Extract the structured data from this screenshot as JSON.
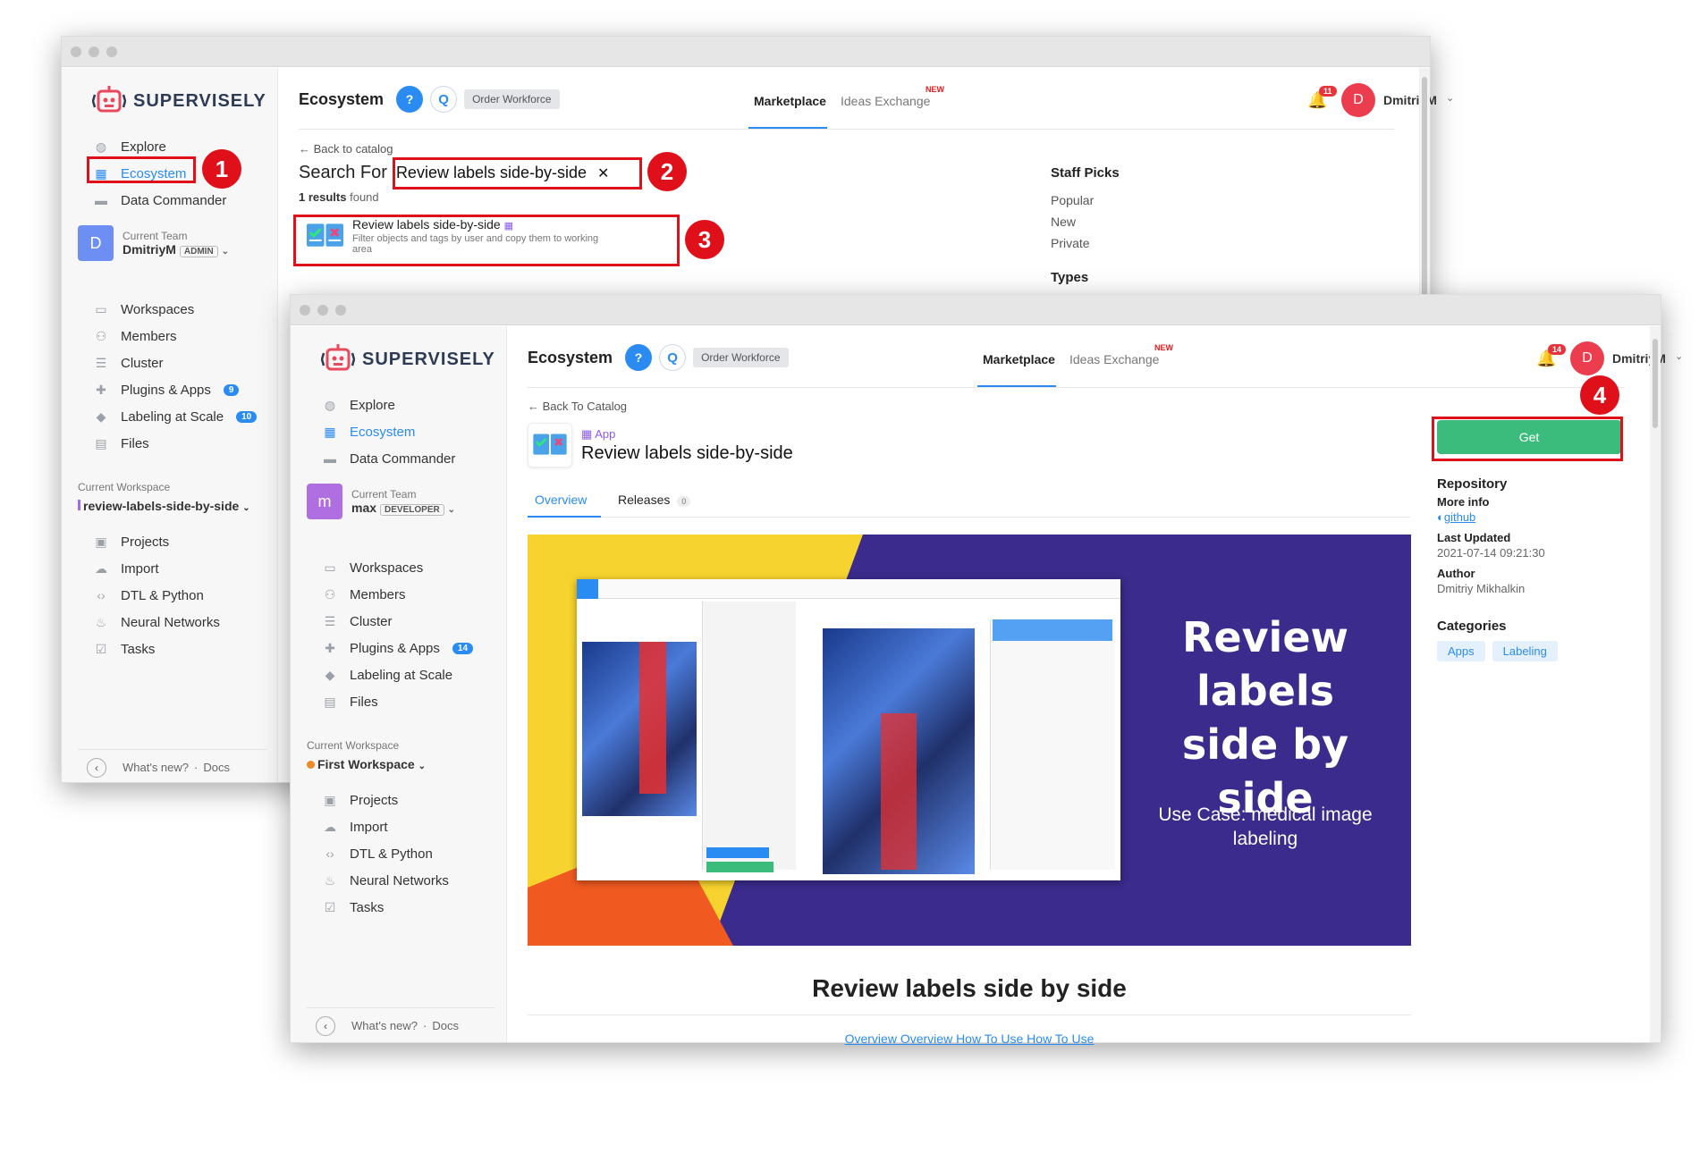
{
  "back_window": {
    "logo": "SUPERVISELY",
    "nav": [
      {
        "label": "Explore",
        "icon": "compass-icon"
      },
      {
        "label": "Ecosystem",
        "icon": "grid-icon"
      },
      {
        "label": "Data Commander",
        "icon": "folder-icon"
      }
    ],
    "team": {
      "avatar": "D",
      "label": "Current Team",
      "name": "DmitriyM",
      "role": "ADMIN"
    },
    "nav2": [
      {
        "label": "Workspaces",
        "icon": "monitor-icon"
      },
      {
        "label": "Members",
        "icon": "members-icon"
      },
      {
        "label": "Cluster",
        "icon": "cluster-icon"
      },
      {
        "label": "Plugins & Apps",
        "icon": "puzzle-icon",
        "badge": "9"
      },
      {
        "label": "Labeling at Scale",
        "icon": "graduation-icon",
        "badge": "10"
      },
      {
        "label": "Files",
        "icon": "file-icon"
      }
    ],
    "workspace": {
      "label": "Current Workspace",
      "name": "review-labels-side-by-side"
    },
    "nav3": [
      {
        "label": "Projects",
        "icon": "projects-icon"
      },
      {
        "label": "Import",
        "icon": "cloud-icon"
      },
      {
        "label": "DTL & Python",
        "icon": "code-icon"
      },
      {
        "label": "Neural Networks",
        "icon": "fire-icon"
      },
      {
        "label": "Tasks",
        "icon": "tasks-icon"
      }
    ],
    "footer": {
      "whats_new": "What's new?",
      "sep": "·",
      "docs": "Docs"
    },
    "header": {
      "title": "Ecosystem",
      "q1": "?",
      "q2": "Q",
      "order": "Order Workforce",
      "tab1": "Marketplace",
      "tab2": "Ideas Exchange",
      "new": "NEW",
      "bell_count": "11",
      "avatar": "D",
      "user": "DmitriyM"
    },
    "back": "← Back to catalog",
    "search_for": "Search For",
    "search_value": "Review labels side-by-side",
    "results_count": "1 results",
    "results_found": "found",
    "result": {
      "title": "Review labels side-by-side",
      "desc": "Filter objects and tags by user and copy them to working area"
    },
    "right": {
      "staff": "Staff Picks",
      "popular": "Popular",
      "new": "New",
      "private": "Private",
      "types": "Types"
    }
  },
  "front_window": {
    "logo": "SUPERVISELY",
    "nav": [
      {
        "label": "Explore",
        "icon": "compass-icon"
      },
      {
        "label": "Ecosystem",
        "icon": "grid-icon"
      },
      {
        "label": "Data Commander",
        "icon": "folder-icon"
      }
    ],
    "team": {
      "avatar": "m",
      "label": "Current Team",
      "name": "max",
      "role": "DEVELOPER"
    },
    "nav2": [
      {
        "label": "Workspaces",
        "icon": "monitor-icon"
      },
      {
        "label": "Members",
        "icon": "members-icon"
      },
      {
        "label": "Cluster",
        "icon": "cluster-icon"
      },
      {
        "label": "Plugins & Apps",
        "icon": "puzzle-icon",
        "badge": "14"
      },
      {
        "label": "Labeling at Scale",
        "icon": "graduation-icon"
      },
      {
        "label": "Files",
        "icon": "file-icon"
      }
    ],
    "workspace": {
      "label": "Current Workspace",
      "name": "First Workspace"
    },
    "nav3": [
      {
        "label": "Projects",
        "icon": "projects-icon"
      },
      {
        "label": "Import",
        "icon": "cloud-icon"
      },
      {
        "label": "DTL & Python",
        "icon": "code-icon"
      },
      {
        "label": "Neural Networks",
        "icon": "fire-icon"
      },
      {
        "label": "Tasks",
        "icon": "tasks-icon"
      }
    ],
    "footer": {
      "whats_new": "What's new?",
      "sep": "·",
      "docs": "Docs"
    },
    "header": {
      "title": "Ecosystem",
      "q1": "?",
      "q2": "Q",
      "order": "Order Workforce",
      "tab1": "Marketplace",
      "tab2": "Ideas Exchange",
      "new": "NEW",
      "bell_count": "14",
      "avatar": "D",
      "user": "DmitriyM"
    },
    "back": "← Back To Catalog",
    "app_tag": "App",
    "app_title": "Review labels side-by-side",
    "tabs": {
      "overview": "Overview",
      "releases": "Releases",
      "releases_count": "0"
    },
    "banner": {
      "line1": "Review",
      "line2": "labels",
      "line3": "side by side",
      "use_case": "Use Case: medical image",
      "use_case2": "labeling"
    },
    "readme_title": "Review labels side by side",
    "readme_links": "Overview Overview How To Use How To Use",
    "get": "Get",
    "repo": {
      "label": "Repository",
      "more": "More info",
      "github": "github"
    },
    "updated": {
      "label": "Last Updated",
      "value": "2021-07-14 09:21:30"
    },
    "author": {
      "label": "Author",
      "value": "Dmitriy Mikhalkin"
    },
    "categories": {
      "label": "Categories",
      "items": [
        "Apps",
        "Labeling"
      ]
    }
  },
  "steps": [
    "1",
    "2",
    "3",
    "4"
  ],
  "colors": {
    "accent": "#2a8bf2",
    "red": "#e0101a",
    "green": "#3cbc7c",
    "purple": "#3a2b8c",
    "yellow": "#f6d32e",
    "orange": "#f05a20"
  }
}
